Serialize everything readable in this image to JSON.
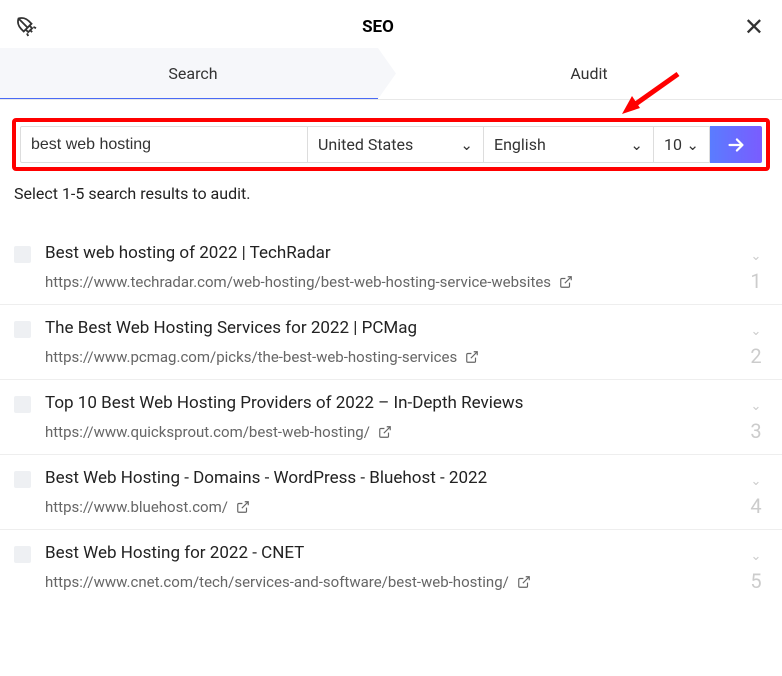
{
  "title": "SEO",
  "tabs": {
    "search": "Search",
    "audit": "Audit"
  },
  "controls": {
    "query": "best web hosting",
    "country": "United States",
    "language": "English",
    "count": "10"
  },
  "instruction": "Select 1-5 search results to audit.",
  "results": [
    {
      "title": "Best web hosting of 2022 | TechRadar",
      "url": "https://www.techradar.com/web-hosting/best-web-hosting-service-websites",
      "num": "1"
    },
    {
      "title": "The Best Web Hosting Services for 2022 | PCMag",
      "url": "https://www.pcmag.com/picks/the-best-web-hosting-services",
      "num": "2"
    },
    {
      "title": "Top 10 Best Web Hosting Providers of 2022 – In-Depth Reviews",
      "url": "https://www.quicksprout.com/best-web-hosting/",
      "num": "3"
    },
    {
      "title": "Best Web Hosting - Domains - WordPress - Bluehost - 2022",
      "url": "https://www.bluehost.com/",
      "num": "4"
    },
    {
      "title": "Best Web Hosting for 2022 - CNET",
      "url": "https://www.cnet.com/tech/services-and-software/best-web-hosting/",
      "num": "5"
    }
  ]
}
